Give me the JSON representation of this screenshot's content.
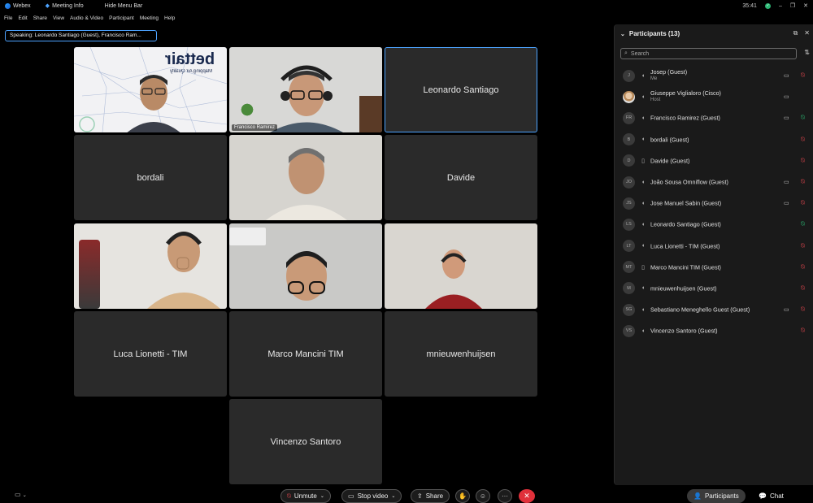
{
  "titlebar": {
    "app_name": "Webex",
    "meeting_info": "Meeting Info",
    "hide_menu_bar": "Hide Menu Bar",
    "clock": "35:41",
    "minimize": "–",
    "restore": "❐",
    "close": "✕"
  },
  "menu": [
    "File",
    "Edit",
    "Share",
    "View",
    "Audio & Video",
    "Participant",
    "Meeting",
    "Help"
  ],
  "speaking": "Speaking: Leonardo Santiago (Guest), Francisco Ram...",
  "tiles": {
    "t1": {
      "brand": "bettair",
      "brand_sub": "Mapping Air Quality"
    },
    "t2": {
      "label": "Francisco Ramirez"
    },
    "t3": {
      "name": "Leonardo Santiago"
    },
    "t4": {
      "name": "bordali"
    },
    "t6": {
      "name": "Davide"
    },
    "t10": {
      "name": "Luca Lionetti - TIM"
    },
    "t11": {
      "name": "Marco Mancini TIM"
    },
    "t12": {
      "name": "mnieuwenhuijsen"
    },
    "t13": {
      "name": "Vincenzo Santoro"
    }
  },
  "panel": {
    "title": "Participants (13)",
    "search_placeholder": "Search",
    "participants": [
      {
        "initials": "J",
        "name": "Josep (Guest)",
        "sub": "Me",
        "video": true,
        "mic": "off"
      },
      {
        "initials": "",
        "name": "Giuseppe Viglialoro (Cisco)",
        "sub": "Host",
        "video": true,
        "mic": "none"
      },
      {
        "initials": "FR",
        "name": "Francisco Ramirez (Guest)",
        "sub": "",
        "video": true,
        "mic": "on"
      },
      {
        "initials": "B",
        "name": "bordali (Guest)",
        "sub": "",
        "video": false,
        "mic": "off"
      },
      {
        "initials": "D",
        "name": "Davide (Guest)",
        "sub": "",
        "video": false,
        "mic": "off"
      },
      {
        "initials": "JO",
        "name": "João Sousa Omniflow (Guest)",
        "sub": "",
        "video": true,
        "mic": "off"
      },
      {
        "initials": "JS",
        "name": "Jose Manuel Sabin (Guest)",
        "sub": "",
        "video": true,
        "mic": "off"
      },
      {
        "initials": "LS",
        "name": "Leonardo Santiago (Guest)",
        "sub": "",
        "video": false,
        "mic": "on"
      },
      {
        "initials": "LT",
        "name": "Luca Lionetti - TIM (Guest)",
        "sub": "",
        "video": false,
        "mic": "off"
      },
      {
        "initials": "MT",
        "name": "Marco Mancini TIM (Guest)",
        "sub": "",
        "video": false,
        "mic": "off"
      },
      {
        "initials": "M",
        "name": "mnieuwenhuijsen (Guest)",
        "sub": "",
        "video": false,
        "mic": "off"
      },
      {
        "initials": "SG",
        "name": "Sebastiano Meneghello Guest (Guest)",
        "sub": "",
        "video": true,
        "mic": "off"
      },
      {
        "initials": "VS",
        "name": "Vincenzo Santoro (Guest)",
        "sub": "",
        "video": false,
        "mic": "off"
      }
    ]
  },
  "bottom": {
    "unmute": "Unmute",
    "stop_video": "Stop video",
    "share": "Share",
    "more": "···",
    "participants": "Participants",
    "chat": "Chat"
  }
}
